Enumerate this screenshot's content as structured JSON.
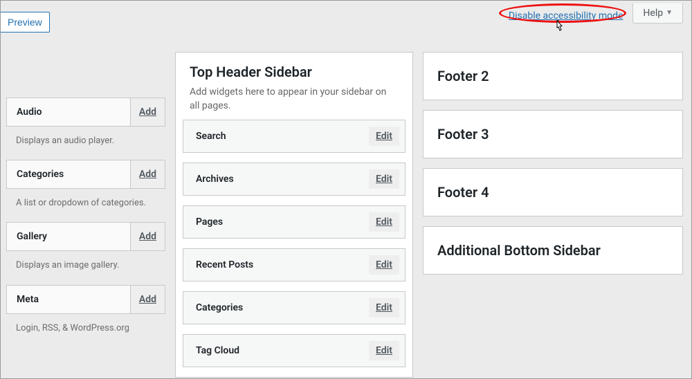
{
  "topbar": {
    "preview_label": "Preview",
    "disable_accessibility_label": "Disable accessibility mode",
    "help_label": "Help"
  },
  "available_widgets": [
    {
      "name": "Audio",
      "add": "Add",
      "desc": "Displays an audio player."
    },
    {
      "name": "Categories",
      "add": "Add",
      "desc": "A list or dropdown of categories."
    },
    {
      "name": "Gallery",
      "add": "Add",
      "desc": "Displays an image gallery."
    },
    {
      "name": "Meta",
      "add": "Add",
      "desc": "Login, RSS, & WordPress.org"
    }
  ],
  "main_sidebar": {
    "title": "Top Header Sidebar",
    "description": "Add widgets here to appear in your sidebar on all pages.",
    "edit_label": "Edit",
    "widgets": [
      "Search",
      "Archives",
      "Pages",
      "Recent Posts",
      "Categories",
      "Tag Cloud"
    ]
  },
  "other_sidebars": [
    "Footer 2",
    "Footer 3",
    "Footer 4",
    "Additional Bottom Sidebar"
  ]
}
